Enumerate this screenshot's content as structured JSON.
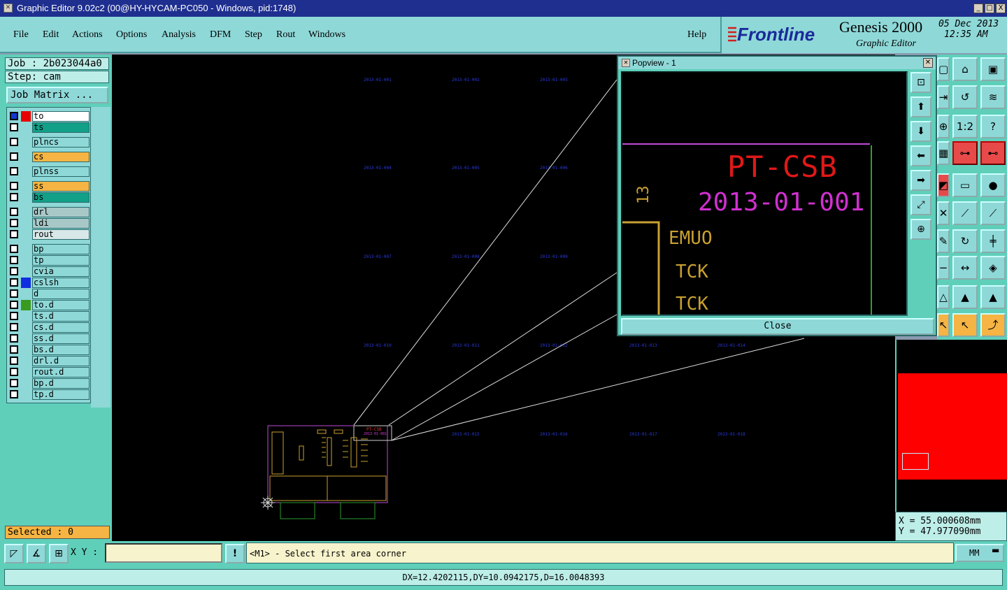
{
  "window": {
    "title": "Graphic Editor 9.02c2 (00@HY-HYCAM-PC050 - Windows, pid:1748)",
    "minimize": "_",
    "maximize": "□",
    "close": "X"
  },
  "menu": [
    "File",
    "Edit",
    "Actions",
    "Options",
    "Analysis",
    "DFM",
    "Step",
    "Rout",
    "Windows"
  ],
  "help": "Help",
  "brand": {
    "logo": "Frontline",
    "product": "Genesis 2000",
    "subtitle": "Graphic Editor",
    "date": "05 Dec 2013",
    "time": "12:35 AM"
  },
  "job": {
    "job": "Job : 2b023044a0",
    "step": "Step: cam",
    "matrix_button": "Job Matrix ..."
  },
  "layers": [
    {
      "name": "to",
      "color": "#ffffff",
      "swatch": "#e80000",
      "checked": true
    },
    {
      "name": "ts",
      "color": "#12a088",
      "swatch": "",
      "checked": false
    },
    {
      "name": "plncs",
      "color": "#8fd8d8",
      "swatch": "",
      "checked": false
    },
    {
      "name": "cs",
      "color": "#f5b443",
      "swatch": "",
      "checked": false
    },
    {
      "name": "plnss",
      "color": "#8fd8d8",
      "swatch": "",
      "checked": false
    },
    {
      "name": "ss",
      "color": "#f5b443",
      "swatch": "",
      "checked": false
    },
    {
      "name": "bs",
      "color": "#12a088",
      "swatch": "",
      "checked": false
    },
    {
      "name": "drl",
      "color": "#a8c8c8",
      "swatch": "",
      "checked": false
    },
    {
      "name": "ldi",
      "color": "#a8c8c8",
      "swatch": "",
      "checked": false
    },
    {
      "name": "rout",
      "color": "#d8e8e8",
      "swatch": "",
      "checked": false
    },
    {
      "name": "bp",
      "color": "#8fd8d8",
      "swatch": "",
      "checked": false
    },
    {
      "name": "tp",
      "color": "#8fd8d8",
      "swatch": "",
      "checked": false
    },
    {
      "name": "cvia",
      "color": "#8fd8d8",
      "swatch": "",
      "checked": false
    },
    {
      "name": "cslsh",
      "color": "#8fd8d8",
      "swatch": "#1030e0",
      "checked": false
    },
    {
      "name": "d",
      "color": "#8fd8d8",
      "swatch": "",
      "checked": false
    },
    {
      "name": "to.d",
      "color": "#8fd8d8",
      "swatch": "#3a9a20",
      "checked": false
    },
    {
      "name": "ts.d",
      "color": "#8fd8d8",
      "swatch": "",
      "checked": false
    },
    {
      "name": "cs.d",
      "color": "#8fd8d8",
      "swatch": "",
      "checked": false
    },
    {
      "name": "ss.d",
      "color": "#8fd8d8",
      "swatch": "",
      "checked": false
    },
    {
      "name": "bs.d",
      "color": "#8fd8d8",
      "swatch": "",
      "checked": false
    },
    {
      "name": "drl.d",
      "color": "#8fd8d8",
      "swatch": "",
      "checked": false
    },
    {
      "name": "rout.d",
      "color": "#8fd8d8",
      "swatch": "",
      "checked": false
    },
    {
      "name": "bp.d",
      "color": "#8fd8d8",
      "swatch": "",
      "checked": false
    },
    {
      "name": "tp.d",
      "color": "#8fd8d8",
      "swatch": "",
      "checked": false
    }
  ],
  "selected": "Selected : 0",
  "popview": {
    "title": "Popview - 1",
    "close_label": "Close",
    "texts": {
      "title": "PT-CSB",
      "code": "2013-01-001",
      "num": "13",
      "l1": "EMUO",
      "l2": "TCK",
      "l3": "TCK"
    }
  },
  "panel_labels": [
    "2013-01-001",
    "2013-01-002",
    "2013-01-003",
    "2013-01-004",
    "2013-01-005",
    "2013-01-006",
    "2013-01-007",
    "2013-01-008",
    "2013-01-009",
    "2013-01-010",
    "2013-01-011",
    "2013-01-012",
    "2013-01-013",
    "2013-01-014",
    "2013-01-015",
    "2013-01-016",
    "2013-01-017",
    "2013-01-018"
  ],
  "board": {
    "title": "PT-CSB",
    "code": "2013-01-001"
  },
  "coords": {
    "x": "X = 55.000608mm",
    "y": "Y = 47.977090mm"
  },
  "bottom": {
    "xy_label": "X Y :",
    "xy_value": "",
    "bang": "!",
    "prompt": "<M1> - Select first area corner",
    "units": "MM",
    "status": "DX=12.4202115,DY=10.0942175,D=16.0048393"
  }
}
